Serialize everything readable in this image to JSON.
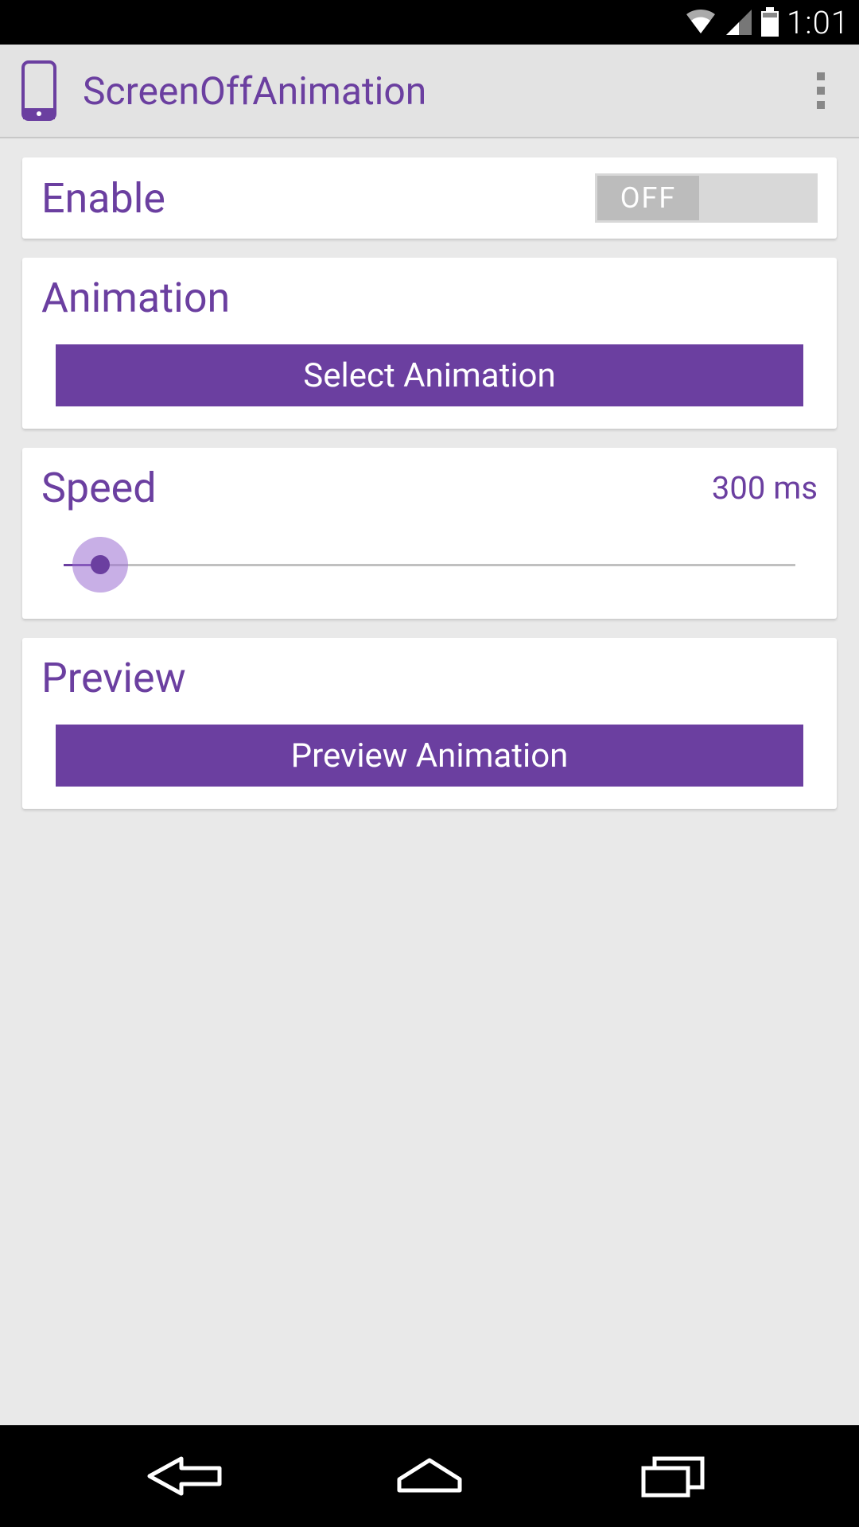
{
  "status": {
    "time": "1:01"
  },
  "header": {
    "title": "ScreenOffAnimation"
  },
  "enable": {
    "label": "Enable",
    "toggle_state": "OFF"
  },
  "animation": {
    "label": "Animation",
    "button_label": "Select Animation"
  },
  "speed": {
    "label": "Speed",
    "value": "300 ms",
    "slider_percent": 5
  },
  "preview": {
    "label": "Preview",
    "button_label": "Preview Animation"
  },
  "colors": {
    "accent": "#6b3fa0"
  }
}
